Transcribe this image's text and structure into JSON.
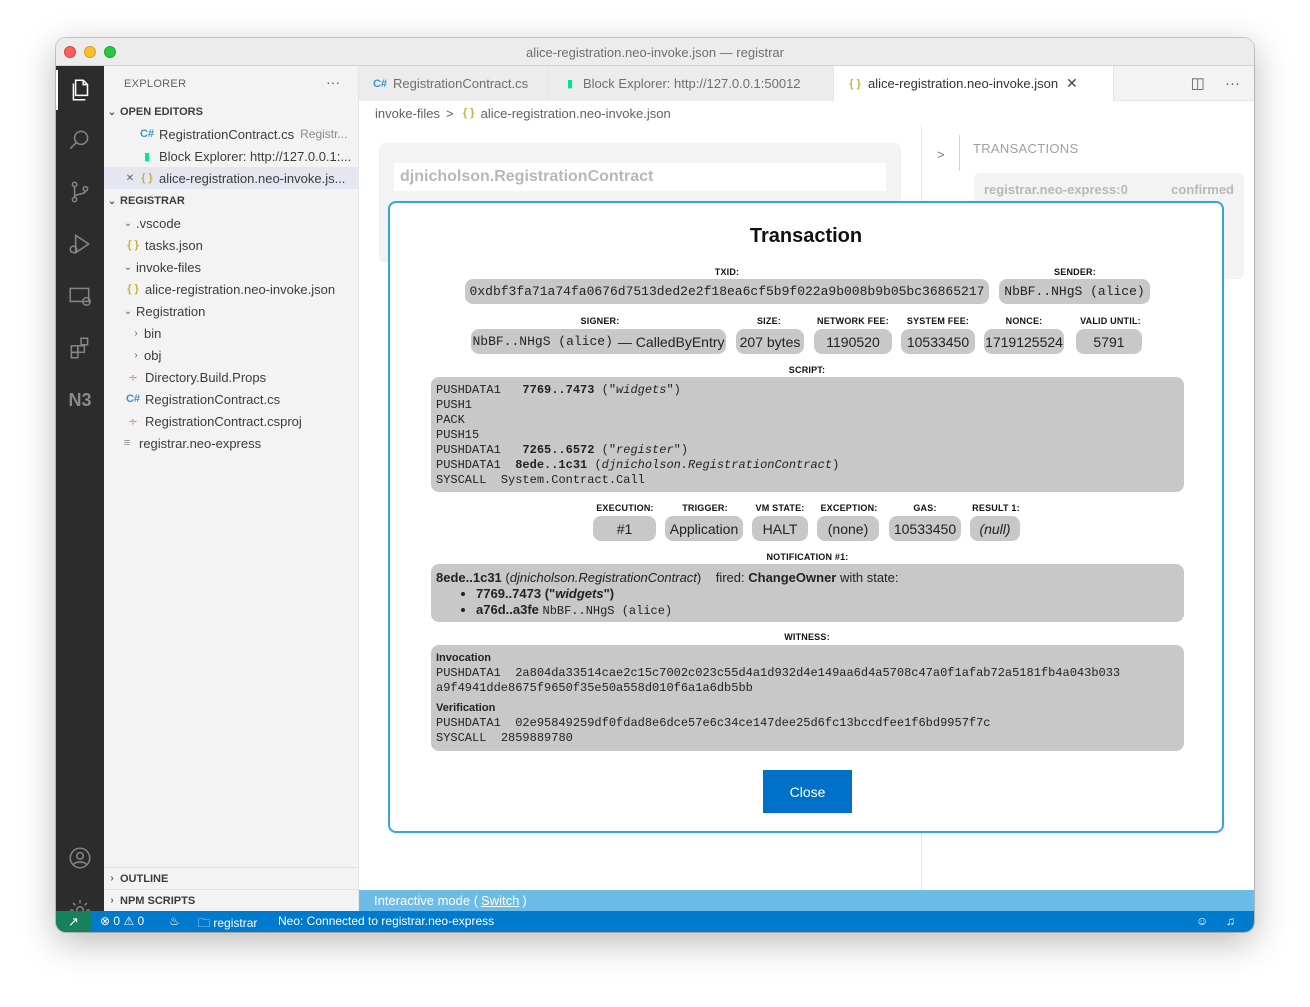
{
  "window": {
    "title": "alice-registration.neo-invoke.json — registrar"
  },
  "sidebar": {
    "header": "EXPLORER",
    "more": "···",
    "open_editors_title": "OPEN EDITORS",
    "open_editors": [
      {
        "label": "RegistrationContract.cs",
        "desc": "Registr..."
      },
      {
        "label": "Block Explorer: http://127.0.0.1:..."
      },
      {
        "label": "alice-registration.neo-invoke.js..."
      }
    ],
    "workspace_title": "REGISTRAR",
    "tree": [
      {
        "label": ".vscode"
      },
      {
        "label": "tasks.json"
      },
      {
        "label": "invoke-files"
      },
      {
        "label": "alice-registration.neo-invoke.json"
      },
      {
        "label": "Registration"
      },
      {
        "label": "bin"
      },
      {
        "label": "obj"
      },
      {
        "label": "Directory.Build.Props"
      },
      {
        "label": "RegistrationContract.cs"
      },
      {
        "label": "RegistrationContract.csproj"
      },
      {
        "label": "registrar.neo-express"
      }
    ],
    "outline": "OUTLINE",
    "npm_scripts": "NPM SCRIPTS"
  },
  "tabs": [
    {
      "label": "RegistrationContract.cs"
    },
    {
      "label": "Block Explorer: http://127.0.0.1:50012"
    },
    {
      "label": "alice-registration.neo-invoke.json",
      "close": "✕"
    }
  ],
  "breadcrumb": {
    "folder": "invoke-files",
    "sep": ">",
    "file": "alice-registration.neo-invoke.json"
  },
  "background": {
    "contract": "djnicholson.RegistrationContract",
    "chevron": ">",
    "transactions_title": "TRANSACTIONS",
    "tx_row": {
      "source": "registrar.neo-express:0",
      "status": "confirmed"
    }
  },
  "modal": {
    "title": "Transaction",
    "labels": {
      "txid": "TXID:",
      "sender": "SENDER:",
      "signer": "SIGNER:",
      "size": "SIZE:",
      "network_fee": "NETWORK FEE:",
      "system_fee": "SYSTEM FEE:",
      "nonce": "NONCE:",
      "valid_until": "VALID UNTIL:",
      "script": "SCRIPT:",
      "execution": "EXECUTION:",
      "trigger": "TRIGGER:",
      "vm_state": "VM STATE:",
      "exception": "EXCEPTION:",
      "gas": "GAS:",
      "result1": "RESULT 1:",
      "notification": "NOTIFICATION #1:",
      "witness": "WITNESS:"
    },
    "txid": "0xdbf3fa71a74fa0676d7513ded2e2f18ea6cf5b9f022a9b008b9b05bc36865217",
    "sender": "NbBF..NHgS (alice)",
    "signer": "NbBF..NHgS (alice)",
    "signer_scope": "— CalledByEntry",
    "size": "207 bytes",
    "network_fee": "1190520",
    "system_fee": "10533450",
    "nonce": "1719125524",
    "valid_until": "5791",
    "script": {
      "l1_op": "PUSHDATA1",
      "l1_val": "7769..7473",
      "l1_open": "(\"",
      "l1_str": "widgets",
      "l1_close": "\")",
      "l2": "PUSH1",
      "l3": "PACK",
      "l4": "PUSH15",
      "l5_op": "PUSHDATA1",
      "l5_val": "7265..6572",
      "l5_open": "(\"",
      "l5_str": "register",
      "l5_close": "\")",
      "l6_op": "PUSHDATA1",
      "l6_val": "8ede..1c31",
      "l6_open": "(",
      "l6_str": "djnicholson.RegistrationContract",
      "l6_close": ")",
      "l7_op": "SYSCALL",
      "l7_val": "System.Contract.Call"
    },
    "execution": "#1",
    "trigger": "Application",
    "vm_state": "HALT",
    "exception": "(none)",
    "gas": "10533450",
    "result1": "(null)",
    "notification": {
      "hash": "8ede..1c31",
      "open": "(",
      "contract": "djnicholson.RegistrationContract",
      "close": ")",
      "fired": "fired:",
      "event": "ChangeOwner",
      "with_state": "with state:",
      "item1_hash": "7769..7473",
      "item1_open": "(\"",
      "item1_str": "widgets",
      "item1_close": "\")",
      "item2_hash": "a76d..a3fe",
      "item2_addr": "NbBF..NHgS (alice)"
    },
    "witness": {
      "invocation_label": "Invocation",
      "inv_op": "PUSHDATA1",
      "inv_line1": "2a804da33514cae2c15c7002c023c55d4a1d932d4e149aa6d4a5708c47a0f1afab72a5181fb4a043b033",
      "inv_line2": "a9f4941dde8675f9650f35e50a558d010f6a1a6db5bb",
      "verification_label": "Verification",
      "ver_op": "PUSHDATA1",
      "ver_val": "02e95849259df0fdad8e6dce57e6c34ce147dee25d6fc13bccdfee1f6bd9957f7c",
      "ver2_op": "SYSCALL",
      "ver2_val": "2859889780"
    },
    "close": "Close"
  },
  "interactive": {
    "text": "Interactive mode (",
    "link": "Switch",
    "end": ")"
  },
  "statusbar": {
    "errors": "0",
    "warnings": "0",
    "folder": "registrar",
    "neo": "Neo: Connected to registrar.neo-express"
  },
  "colors": {
    "accent": "#007acc",
    "modal_border": "#38a4dc",
    "button": "#0070c9",
    "remote": "#16825d",
    "interactive_bar": "#6bbde8"
  }
}
